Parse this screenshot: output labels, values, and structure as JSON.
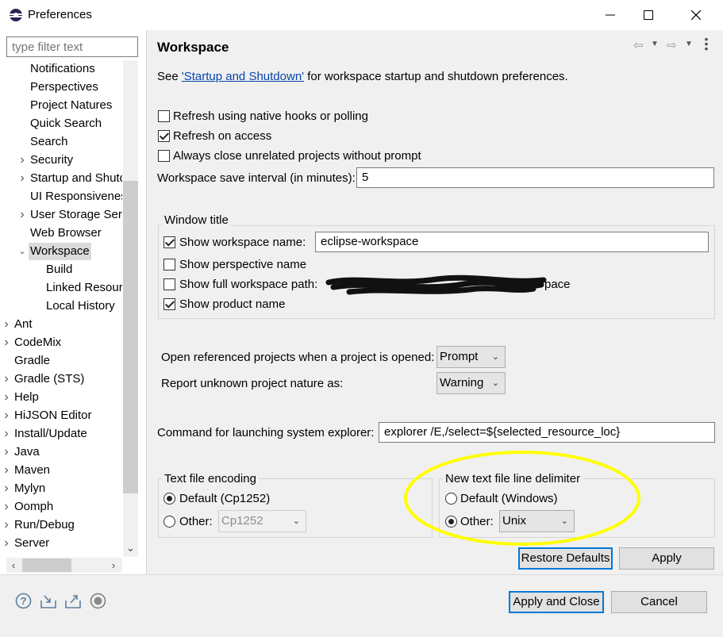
{
  "window": {
    "title": "Preferences"
  },
  "filter": {
    "placeholder": "type filter text"
  },
  "tree": {
    "items": [
      {
        "label": "Notifications",
        "level": 2,
        "expandable": false
      },
      {
        "label": "Perspectives",
        "level": 2,
        "expandable": false
      },
      {
        "label": "Project Natures",
        "level": 2,
        "expandable": false
      },
      {
        "label": "Quick Search",
        "level": 2,
        "expandable": false
      },
      {
        "label": "Search",
        "level": 2,
        "expandable": false
      },
      {
        "label": "Security",
        "level": 2,
        "expandable": true,
        "expanded": false
      },
      {
        "label": "Startup and Shutdown",
        "level": 2,
        "expandable": true,
        "expanded": false
      },
      {
        "label": "UI Responsiveness Monitoring",
        "level": 2,
        "expandable": false
      },
      {
        "label": "User Storage Service",
        "level": 2,
        "expandable": true,
        "expanded": false
      },
      {
        "label": "Web Browser",
        "level": 2,
        "expandable": false
      },
      {
        "label": "Workspace",
        "level": 2,
        "expandable": true,
        "expanded": true,
        "selected": true
      },
      {
        "label": "Build",
        "level": 3,
        "expandable": false
      },
      {
        "label": "Linked Resources",
        "level": 3,
        "expandable": false
      },
      {
        "label": "Local History",
        "level": 3,
        "expandable": false
      },
      {
        "label": "Ant",
        "level": 1,
        "expandable": true,
        "expanded": false
      },
      {
        "label": "CodeMix",
        "level": 1,
        "expandable": true,
        "expanded": false
      },
      {
        "label": "Gradle",
        "level": 1,
        "expandable": false
      },
      {
        "label": "Gradle (STS)",
        "level": 1,
        "expandable": true,
        "expanded": false
      },
      {
        "label": "Help",
        "level": 1,
        "expandable": true,
        "expanded": false
      },
      {
        "label": "HiJSON Editor",
        "level": 1,
        "expandable": true,
        "expanded": false
      },
      {
        "label": "Install/Update",
        "level": 1,
        "expandable": true,
        "expanded": false
      },
      {
        "label": "Java",
        "level": 1,
        "expandable": true,
        "expanded": false
      },
      {
        "label": "Maven",
        "level": 1,
        "expandable": true,
        "expanded": false
      },
      {
        "label": "Mylyn",
        "level": 1,
        "expandable": true,
        "expanded": false
      },
      {
        "label": "Oomph",
        "level": 1,
        "expandable": true,
        "expanded": false
      },
      {
        "label": "Run/Debug",
        "level": 1,
        "expandable": true,
        "expanded": false
      },
      {
        "label": "Server",
        "level": 1,
        "expandable": true,
        "expanded": false
      }
    ]
  },
  "page": {
    "title": "Workspace",
    "intro_prefix": "See ",
    "intro_link": "'Startup and Shutdown'",
    "intro_suffix": " for workspace startup and shutdown preferences.",
    "refresh_native": {
      "label": "Refresh using native hooks or polling",
      "checked": false
    },
    "refresh_access": {
      "label": "Refresh on access",
      "checked": true
    },
    "always_close": {
      "label": "Always close unrelated projects without prompt",
      "checked": false
    },
    "save_interval": {
      "label": "Workspace save interval (in minutes):",
      "value": "5"
    },
    "window_title": {
      "group_label": "Window title",
      "show_workspace_name": {
        "label": "Show workspace name:",
        "checked": true,
        "value": "eclipse-workspace"
      },
      "show_perspective_name": {
        "label": "Show perspective name",
        "checked": false
      },
      "show_full_path": {
        "label": "Show full workspace path:",
        "checked": false,
        "value_visible_tail": "pace"
      },
      "show_product_name": {
        "label": "Show product name",
        "checked": true
      }
    },
    "open_referenced": {
      "label": "Open referenced projects when a project is opened:",
      "value": "Prompt"
    },
    "report_unknown": {
      "label": "Report unknown project nature as:",
      "value": "Warning"
    },
    "command_explorer": {
      "label": "Command for launching system explorer:",
      "value": "explorer /E,/select=${selected_resource_loc}"
    },
    "encoding": {
      "group_label": "Text file encoding",
      "default_label": "Default (Cp1252)",
      "other_label": "Other:",
      "other_value": "Cp1252",
      "selected": "default"
    },
    "delimiter": {
      "group_label": "New text file line delimiter",
      "default_label": "Default (Windows)",
      "other_label": "Other:",
      "other_value": "Unix",
      "selected": "other"
    },
    "restore_defaults": "Restore Defaults",
    "apply": "Apply"
  },
  "footer": {
    "apply_close": "Apply and Close",
    "cancel": "Cancel",
    "icons": [
      "help-icon",
      "import-icon",
      "export-icon",
      "record-icon"
    ]
  },
  "colors": {
    "highlight_circle": "#ffff00",
    "link": "#0645ad",
    "panel_bg": "#f0f0f0",
    "focus_border": "#0078d7"
  }
}
